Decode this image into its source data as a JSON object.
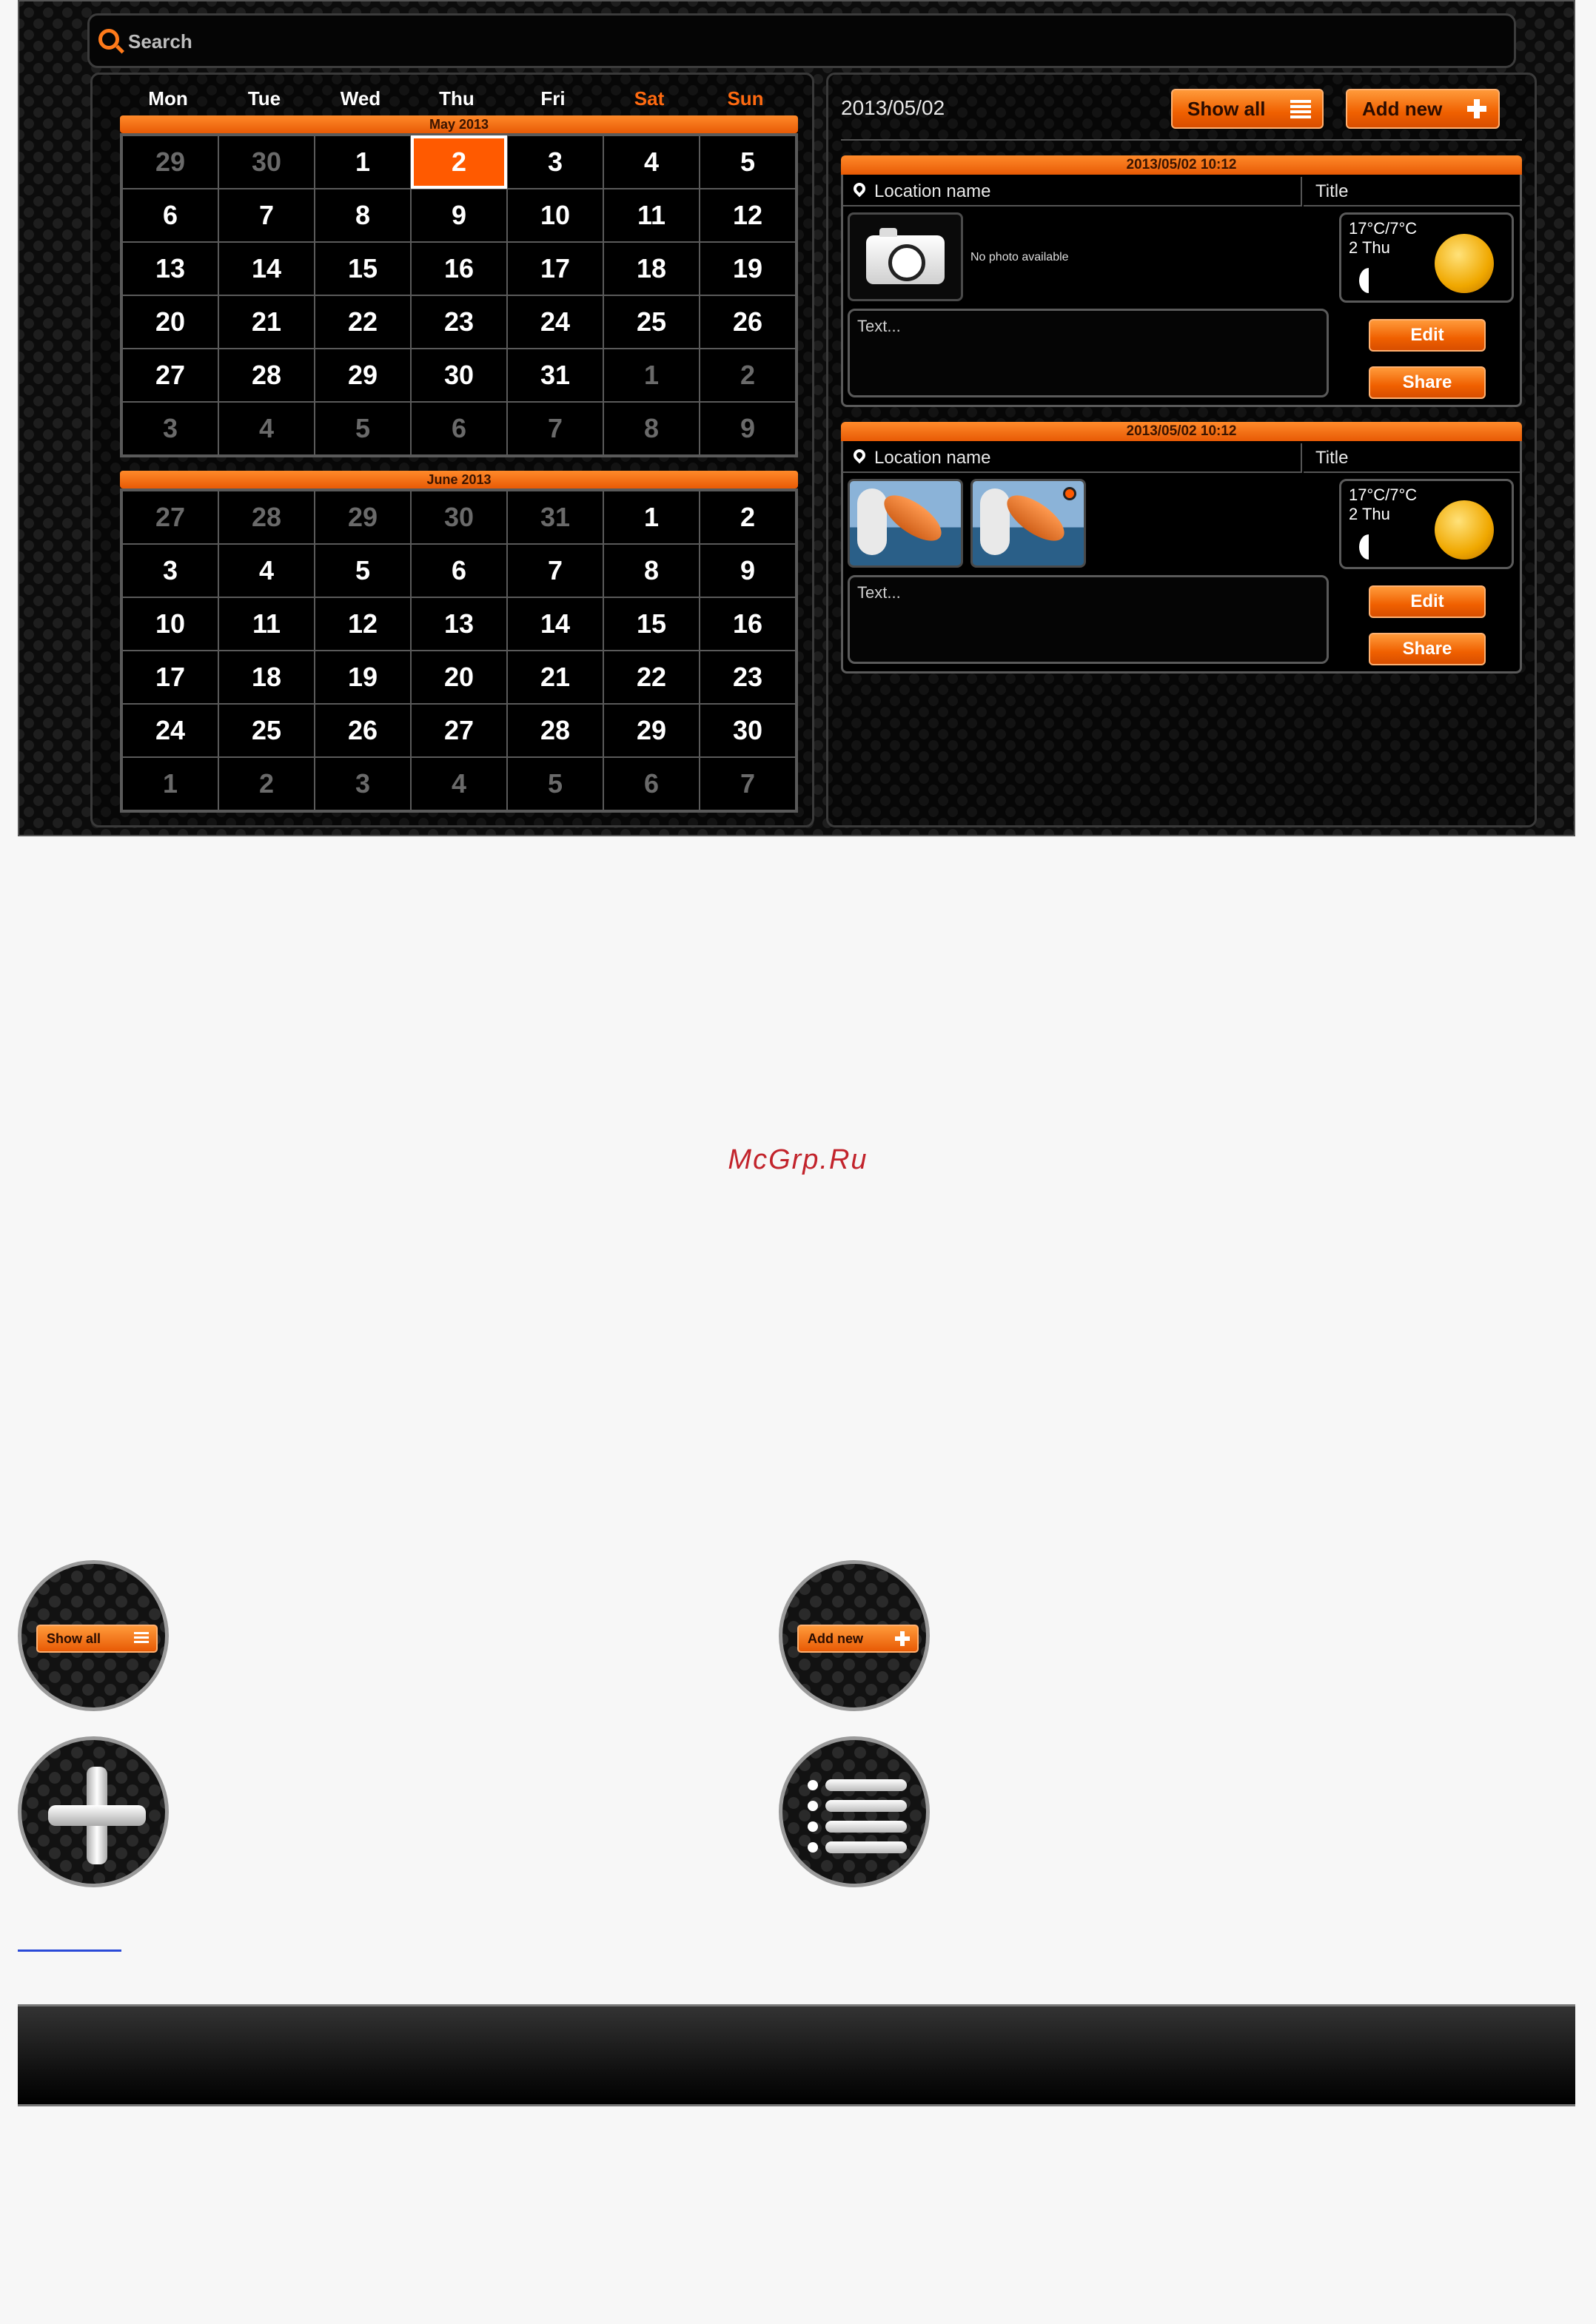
{
  "search": {
    "placeholder": "Search"
  },
  "calendar": {
    "weekdays": [
      "Mon",
      "Tue",
      "Wed",
      "Thu",
      "Fri",
      "Sat",
      "Sun"
    ],
    "months": [
      {
        "label": "May 2013",
        "days": [
          [
            {
              "d": "29",
              "o": true
            },
            {
              "d": "30",
              "o": true
            },
            {
              "d": "1"
            },
            {
              "d": "2",
              "sel": true
            },
            {
              "d": "3"
            },
            {
              "d": "4"
            },
            {
              "d": "5"
            }
          ],
          [
            {
              "d": "6"
            },
            {
              "d": "7"
            },
            {
              "d": "8"
            },
            {
              "d": "9"
            },
            {
              "d": "10"
            },
            {
              "d": "11"
            },
            {
              "d": "12"
            }
          ],
          [
            {
              "d": "13"
            },
            {
              "d": "14"
            },
            {
              "d": "15"
            },
            {
              "d": "16"
            },
            {
              "d": "17"
            },
            {
              "d": "18"
            },
            {
              "d": "19"
            }
          ],
          [
            {
              "d": "20"
            },
            {
              "d": "21"
            },
            {
              "d": "22"
            },
            {
              "d": "23"
            },
            {
              "d": "24"
            },
            {
              "d": "25"
            },
            {
              "d": "26"
            }
          ],
          [
            {
              "d": "27"
            },
            {
              "d": "28"
            },
            {
              "d": "29"
            },
            {
              "d": "30"
            },
            {
              "d": "31"
            },
            {
              "d": "1",
              "o": true
            },
            {
              "d": "2",
              "o": true
            }
          ],
          [
            {
              "d": "3",
              "o": true
            },
            {
              "d": "4",
              "o": true
            },
            {
              "d": "5",
              "o": true
            },
            {
              "d": "6",
              "o": true
            },
            {
              "d": "7",
              "o": true
            },
            {
              "d": "8",
              "o": true
            },
            {
              "d": "9",
              "o": true
            }
          ]
        ]
      },
      {
        "label": "June 2013",
        "days": [
          [
            {
              "d": "27",
              "o": true
            },
            {
              "d": "28",
              "o": true
            },
            {
              "d": "29",
              "o": true
            },
            {
              "d": "30",
              "o": true
            },
            {
              "d": "31",
              "o": true
            },
            {
              "d": "1"
            },
            {
              "d": "2"
            }
          ],
          [
            {
              "d": "3"
            },
            {
              "d": "4"
            },
            {
              "d": "5"
            },
            {
              "d": "6"
            },
            {
              "d": "7"
            },
            {
              "d": "8"
            },
            {
              "d": "9"
            }
          ],
          [
            {
              "d": "10"
            },
            {
              "d": "11"
            },
            {
              "d": "12"
            },
            {
              "d": "13"
            },
            {
              "d": "14"
            },
            {
              "d": "15"
            },
            {
              "d": "16"
            }
          ],
          [
            {
              "d": "17"
            },
            {
              "d": "18"
            },
            {
              "d": "19"
            },
            {
              "d": "20"
            },
            {
              "d": "21"
            },
            {
              "d": "22"
            },
            {
              "d": "23"
            }
          ],
          [
            {
              "d": "24"
            },
            {
              "d": "25"
            },
            {
              "d": "26"
            },
            {
              "d": "27"
            },
            {
              "d": "28"
            },
            {
              "d": "29"
            },
            {
              "d": "30"
            }
          ],
          [
            {
              "d": "1",
              "o": true
            },
            {
              "d": "2",
              "o": true
            },
            {
              "d": "3",
              "o": true
            },
            {
              "d": "4",
              "o": true
            },
            {
              "d": "5",
              "o": true
            },
            {
              "d": "6",
              "o": true
            },
            {
              "d": "7",
              "o": true
            }
          ]
        ]
      }
    ]
  },
  "detail": {
    "date": "2013/05/02",
    "show_all_label": "Show all",
    "add_new_label": "Add new",
    "entries": [
      {
        "timestamp": "2013/05/02 10:12",
        "location": "Location name",
        "title": "Title",
        "no_photo": "No photo available",
        "weather_temp": "17°C/7°C",
        "weather_day": "2 Thu",
        "text": "Text...",
        "edit_label": "Edit",
        "share_label": "Share"
      },
      {
        "timestamp": "2013/05/02 10:12",
        "location": "Location name",
        "title": "Title",
        "weather_temp": "17°C/7°C",
        "weather_day": "2 Thu",
        "text": "Text...",
        "edit_label": "Edit",
        "share_label": "Share"
      }
    ]
  },
  "callouts": {
    "show_all_label": "Show all",
    "add_new_label": "Add new"
  },
  "watermark": "McGrp.Ru",
  "colors": {
    "accent": "#ff6a10",
    "selected_day": "#ff5a00",
    "background": "#0c0c0c",
    "watermark": "#c2232b"
  }
}
